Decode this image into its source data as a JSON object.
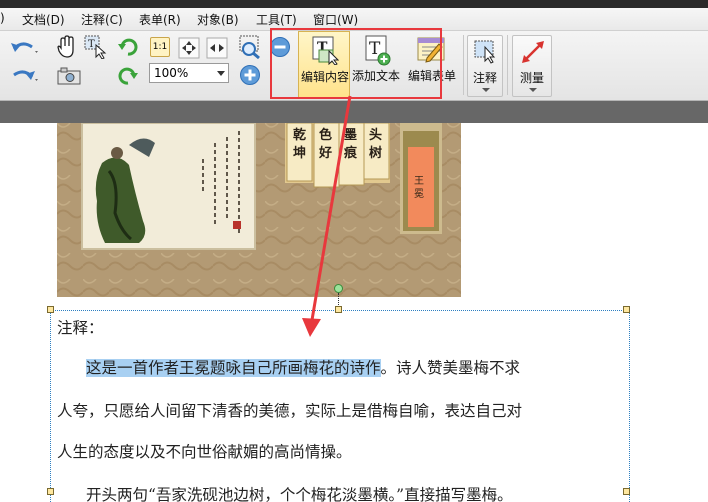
{
  "menubar": {
    "items": [
      ")",
      "文档(D)",
      "注释(C)",
      "表单(R)",
      "对象(B)",
      "工具(T)",
      "窗口(W)"
    ]
  },
  "toolbar": {
    "zoom_value": "100%",
    "zoom_fit_label": "1:1",
    "edit_content_label": "编辑内容",
    "add_text_label": "添加文本",
    "edit_form_label": "编辑表单",
    "annotate_label": "注释",
    "measure_label": "测量"
  },
  "painting": {
    "poem_columns": [
      "乾坤",
      "色好",
      "墨痕",
      "头树"
    ],
    "author_tag": "王冕"
  },
  "document": {
    "note_label": "注释：",
    "highlighted_sentence": "这是一首作者王冕题咏自己所画梅花的诗作",
    "line1_rest": "。诗人赞美墨梅不求",
    "line2": "人夸，只愿给人间留下清香的美德，实际上是借梅自喻，表达自己对",
    "line3": "人生的态度以及不向世俗献媚的高尚情操。",
    "line4": "开头两句“吾家洗砚池边树，个个梅花淡墨横。”直接描写墨梅。"
  },
  "colors": {
    "highlight": "#a8d0f2",
    "annotation_red": "#e8383d",
    "selection_frame": "#2d7fc1"
  }
}
